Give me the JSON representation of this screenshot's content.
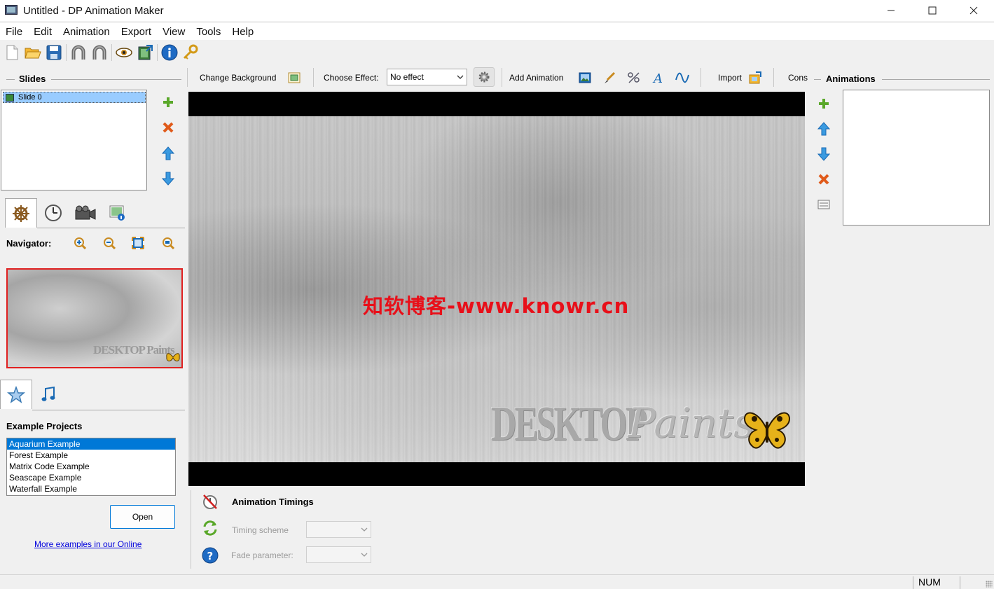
{
  "window": {
    "title": "Untitled - DP Animation Maker",
    "controls": {
      "minimize": "—",
      "maximize": "☐",
      "close": "✕"
    }
  },
  "menu": [
    "File",
    "Edit",
    "Animation",
    "Export",
    "View",
    "Tools",
    "Help"
  ],
  "toolbar": {
    "buttons": [
      "new-icon",
      "open-folder-icon",
      "save-icon",
      "undo-icon",
      "redo-icon",
      "preview-eye-icon",
      "export-film-icon",
      "info-icon",
      "key-icon"
    ]
  },
  "slides": {
    "header": "Slides",
    "items": [
      {
        "label": "Slide 0",
        "selected": true
      }
    ]
  },
  "navigator": {
    "label": "Navigator:"
  },
  "preview": {
    "logo_text": "DESKTOP Paints"
  },
  "examples": {
    "header": "Example Projects",
    "items": [
      {
        "label": "Aquarium Example",
        "selected": true
      },
      {
        "label": "Forest Example",
        "selected": false
      },
      {
        "label": "Matrix Code Example",
        "selected": false
      },
      {
        "label": "Seascape Example",
        "selected": false
      },
      {
        "label": "Waterfall Example",
        "selected": false
      }
    ],
    "open_label": "Open",
    "more_link": "More examples in our Online"
  },
  "scene_toolbar": {
    "change_background": "Change Background",
    "choose_effect_label": "Choose Effect:",
    "effect_value": "No effect",
    "add_animation": "Add Animation",
    "import": "Import",
    "cons": "Cons"
  },
  "canvas": {
    "watermark": "知软博客-www.knowr.cn",
    "logo_desktop": "DESKTOP",
    "logo_paints": "Paints"
  },
  "timings": {
    "title": "Animation Timings",
    "timing_scheme_label": "Timing scheme",
    "fade_parameter_label": "Fade parameter:"
  },
  "animations": {
    "header": "Animations"
  },
  "status": {
    "num": "NUM"
  },
  "colors": {
    "selection": "#0078d7",
    "slide_selection": "#99ccff",
    "preview_border": "#e02020",
    "watermark": "#e8101a"
  }
}
